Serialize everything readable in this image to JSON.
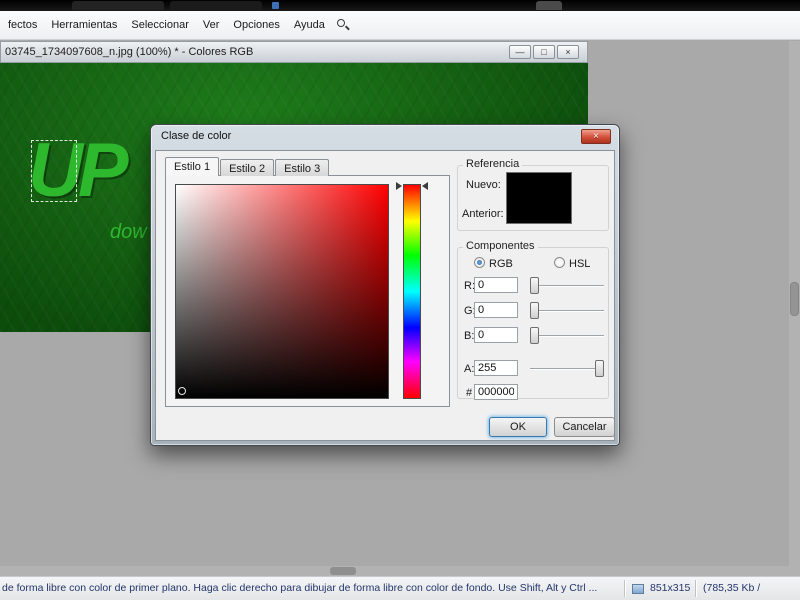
{
  "menu_bar": {
    "items": [
      "fectos",
      "Herramientas",
      "Seleccionar",
      "Ver",
      "Opciones",
      "Ayuda"
    ]
  },
  "doc_window": {
    "title": "03745_1734097608_n.jpg (100%) * - Colores RGB",
    "controls": {
      "minimize": "—",
      "restore": "□",
      "close": "×"
    }
  },
  "canvas": {
    "headline": "UP",
    "subtext": "dow"
  },
  "dialog": {
    "title": "Clase de color",
    "close_glyph": "×",
    "tabs": [
      "Estilo 1",
      "Estilo 2",
      "Estilo 3"
    ],
    "reference": {
      "label": "Referencia",
      "new": "Nuevo:",
      "previous": "Anterior:",
      "swatch_color": "#000000"
    },
    "components": {
      "label": "Componentes",
      "rgb_label": "RGB",
      "hsl_label": "HSL",
      "r": {
        "label": "R:",
        "value": "0"
      },
      "g": {
        "label": "G:",
        "value": "0"
      },
      "b": {
        "label": "B:",
        "value": "0"
      },
      "a": {
        "label": "A:",
        "value": "255"
      },
      "hex": {
        "label": "#",
        "value": "000000"
      }
    },
    "ok_label": "OK",
    "cancel_label": "Cancelar"
  },
  "status_bar": {
    "message": "de forma libre con color de primer plano. Haga clic derecho para dibujar de forma libre con color de fondo. Use Shift, Alt y Ctrl ...",
    "image_size": "851x315",
    "file_info": "(785,35 Kb /"
  },
  "colors": {
    "headline_green": "#2eb82e",
    "swatch_black": "#000000",
    "workspace_gray": "#a9a9a9"
  }
}
